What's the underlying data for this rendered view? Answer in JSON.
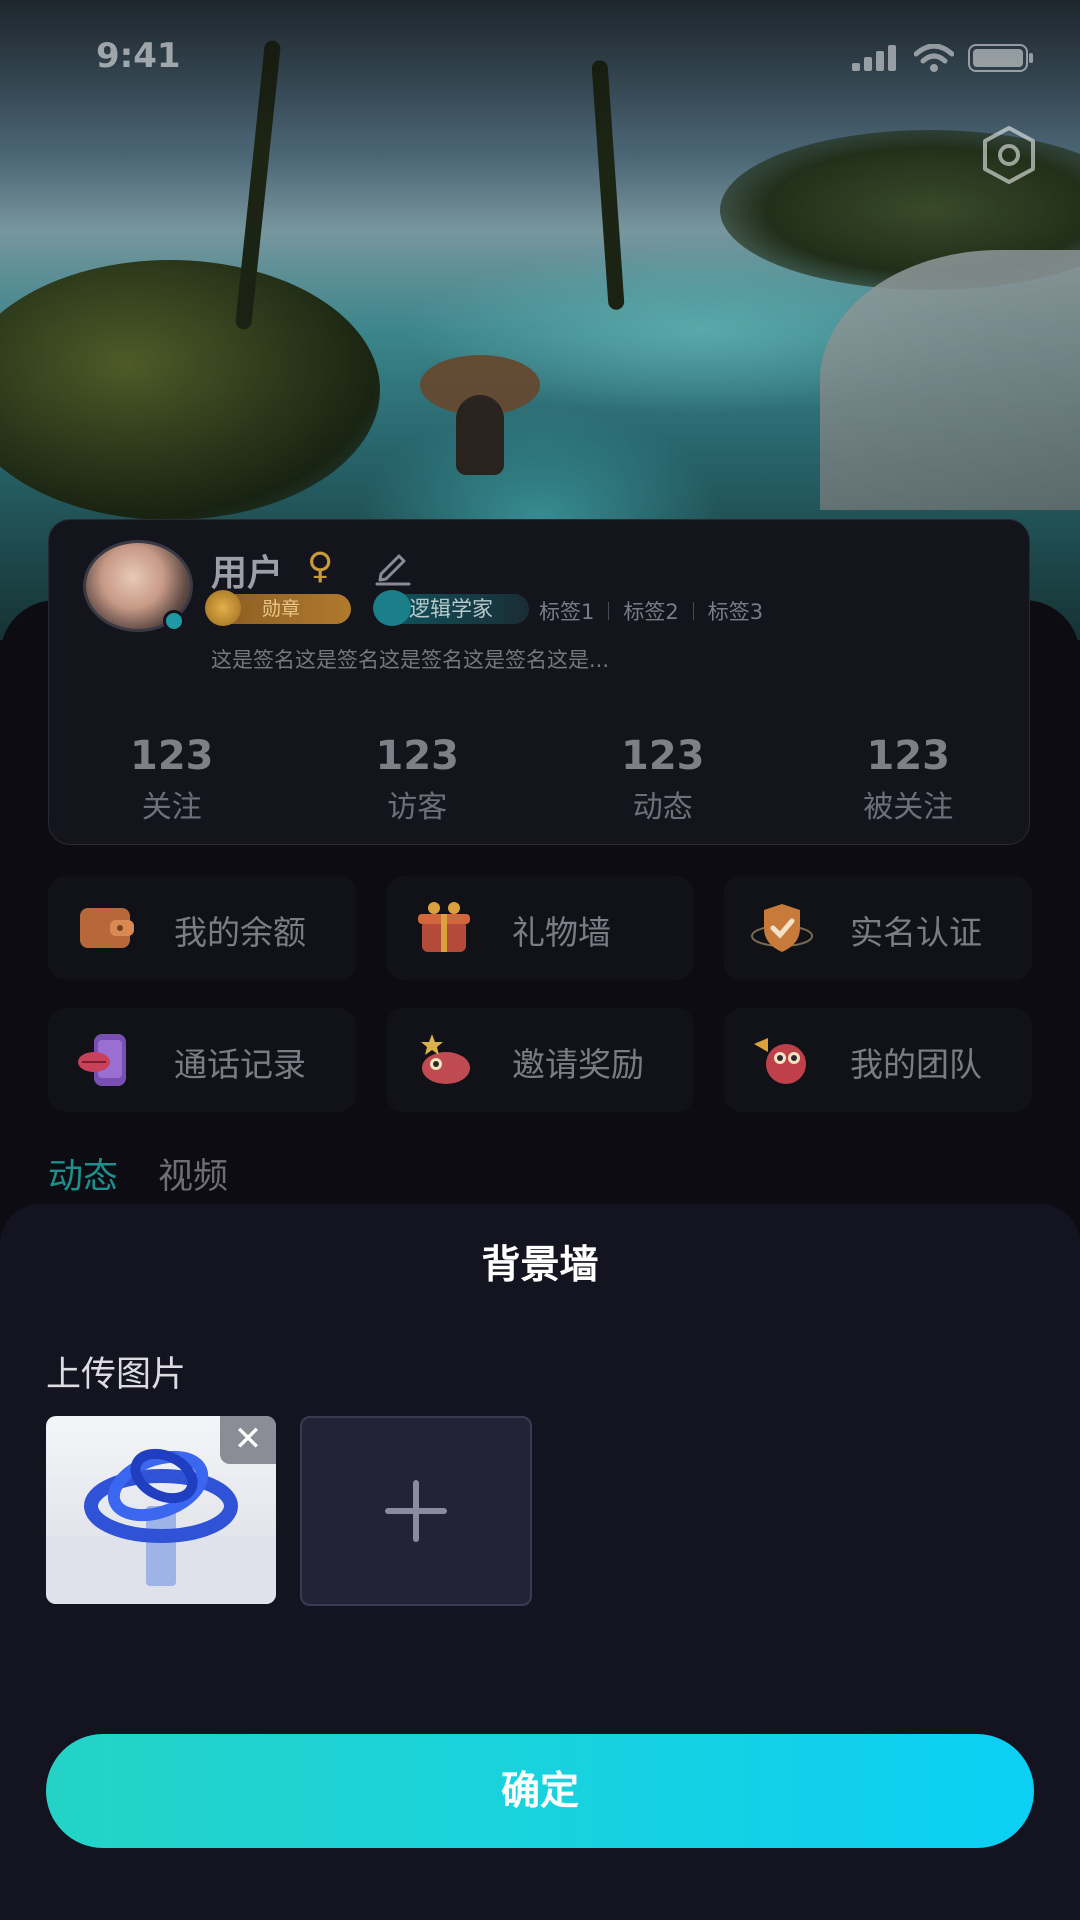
{
  "status_bar": {
    "time": "9:41"
  },
  "profile": {
    "username": "用户",
    "gender_symbol": "♀",
    "medal_label": "勋章",
    "main_tag": "逻辑学家",
    "tags": [
      "标签1",
      "标签2",
      "标签3"
    ],
    "signature": "这是签名这是签名这是签名这是签名这是...",
    "stats": [
      {
        "value": "123",
        "label": "关注"
      },
      {
        "value": "123",
        "label": "访客"
      },
      {
        "value": "123",
        "label": "动态"
      },
      {
        "value": "123",
        "label": "被关注"
      }
    ]
  },
  "menu": [
    {
      "label": "我的余额",
      "icon": "wallet-icon"
    },
    {
      "label": "礼物墙",
      "icon": "gift-icon"
    },
    {
      "label": "实名认证",
      "icon": "shield-check-icon"
    },
    {
      "label": "通话记录",
      "icon": "phone-lips-icon"
    },
    {
      "label": "邀请奖励",
      "icon": "invite-reward-icon"
    },
    {
      "label": "我的团队",
      "icon": "team-mascot-icon"
    }
  ],
  "tabs": {
    "active": "动态",
    "inactive": "视频"
  },
  "sheet": {
    "title": "背景墙",
    "upload_label": "上传图片",
    "add_symbol": "+",
    "confirm_label": "确定"
  },
  "colors": {
    "accent_teal": "#1f8f8c",
    "button_gradient_start": "#25d3c6",
    "button_gradient_end": "#0bd0f4"
  }
}
